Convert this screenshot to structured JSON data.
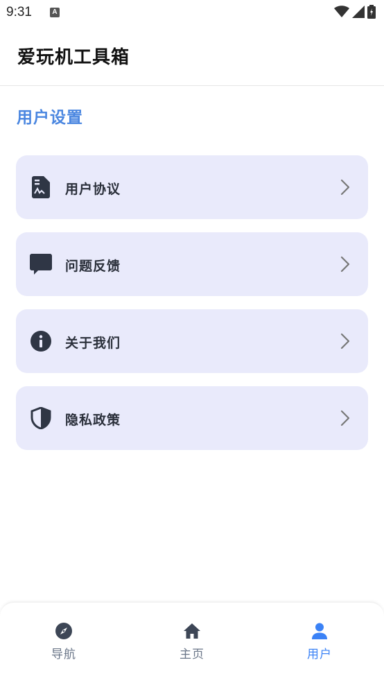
{
  "status_bar": {
    "time": "9:31",
    "notification_icon": "A"
  },
  "header": {
    "title": "爱玩机工具箱"
  },
  "section": {
    "title": "用户设置"
  },
  "settings": [
    {
      "label": "用户协议",
      "icon": "document-icon"
    },
    {
      "label": "问题反馈",
      "icon": "chat-icon"
    },
    {
      "label": "关于我们",
      "icon": "info-icon"
    },
    {
      "label": "隐私政策",
      "icon": "shield-icon"
    }
  ],
  "bottom_nav": {
    "items": [
      {
        "label": "导航",
        "icon": "compass-icon",
        "active": false
      },
      {
        "label": "主页",
        "icon": "home-icon",
        "active": false
      },
      {
        "label": "用户",
        "icon": "user-icon",
        "active": true
      }
    ]
  },
  "colors": {
    "accent": "#4a86e0",
    "card_bg": "#e9eafb",
    "icon_dark": "#2f3645",
    "nav_inactive": "#6a7688",
    "nav_active": "#3b82f6"
  }
}
